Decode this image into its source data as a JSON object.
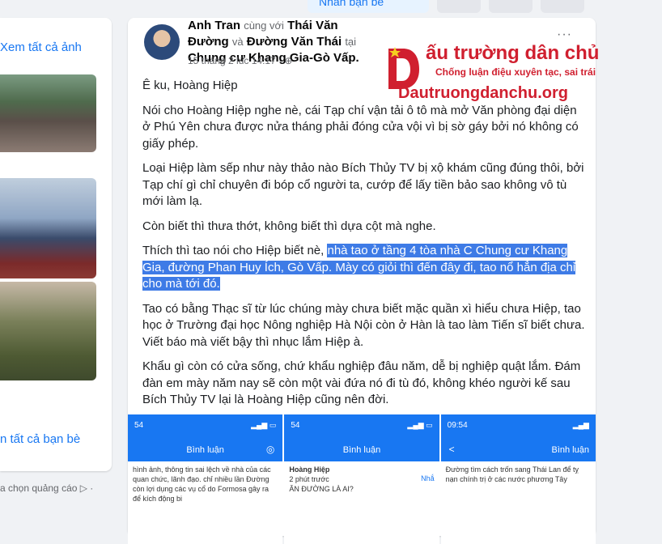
{
  "top_buttons": {
    "primary": "Nhắn bạn bè"
  },
  "left_panel": {
    "see_all_photos": "Xem tất cả ảnh",
    "see_all_friends": "n tất cả bạn bè",
    "ad_choices": "a chọn quảng cáo ▷ ·"
  },
  "post": {
    "author": "Anh Tran",
    "with_text": "cùng với",
    "tag1": "Thái Văn Đường",
    "and_text": "và",
    "tag2": "Đường Văn Thái",
    "at_text": "tại",
    "place": "Chung cư Khang Gia-Gò Vấp.",
    "timestamp": "15 tháng 2 lúc 14:17 · ",
    "globe": "⊕",
    "more": "···",
    "paragraphs": [
      "Ê ku, Hoàng Hiệp",
      "Nói cho Hoàng Hiệp nghe nè, cái Tạp chí vận tải ô tô mà mở Văn phòng đại diện ở Phú Yên chưa được nửa tháng phải đóng cửa vội vì bị sờ gáy bởi nó không có giấy phép.",
      "Loại Hiệp làm sếp như này thảo nào Bích Thủy TV bị xộ khám cũng đúng thôi, bởi Tạp chí gì chỉ chuyên đi bóp cổ người ta, cướp để lấy tiền bảo sao không vô tù mới làm lạ.",
      "Còn biết thì thưa thớt, không biết thì dựa cột mà nghe."
    ],
    "highlight_pre": "Thích thì tao nói cho Hiệp biết nè, ",
    "highlight": "nhà tao ở tầng 4 tòa nhà C Chung cư Khang Gia, đường Phan Huy Ích, Gò Vấp. Mày có giỏi thì đến đây đi, tao nổ hẳn địa chỉ cho mà tới đó.",
    "paragraphs2": [
      "Tao có bằng Thạc sĩ từ lúc chúng mày chưa biết mặc quần xì hiểu chưa Hiệp, tao học ở Trường đại học Nông nghiệp Hà Nội còn ở Hàn là tao làm Tiến sĩ biết chưa. Viết báo mà viết bậy thì nhục lắm Hiệp à.",
      "Khẩu gì còn có cửa sống, chứ khẩu nghiệp đâu năm, dễ bị nghiệp quật lắm. Đám đàn em mày năm nay sẽ còn một vài đứa nó đi tù đó, không khéo người kế sau Bích Thủy TV lại là Hoàng Hiệp cũng nên đời."
    ]
  },
  "watermark": {
    "brand_line": "ấu trường dân chủ",
    "slogan": "Chống luận điệu xuyên tạc, sai trái",
    "site": "Dautruongdanchu.org"
  },
  "screenshots": [
    {
      "time": "54",
      "signal": "▂▄▆ ▭",
      "title": "Bình luận",
      "icon": "◎",
      "text": "hình ảnh, thông tin sai lệch về nhà của các quan chức, lãnh đạo. chỉ nhiều lần Đường còn lợi dụng các vụ cổ do Formosa gây ra để kích động bi"
    },
    {
      "time": "54",
      "signal": "▂▄▆ ▭",
      "title": "Bình luận",
      "name": "Hoàng Hiệp",
      "ago": "2 phút trước",
      "tag": "Nhắ",
      "text": "ĂN ĐƯỜNG LÀ AI?"
    },
    {
      "time": "09:54",
      "signal": "▂▄▆",
      "title": "Bình luận",
      "back": "<",
      "text": "Đường tìm cách trốn sang Thái Lan để tỵ nạn chính trị ở các nước phương Tây"
    }
  ]
}
